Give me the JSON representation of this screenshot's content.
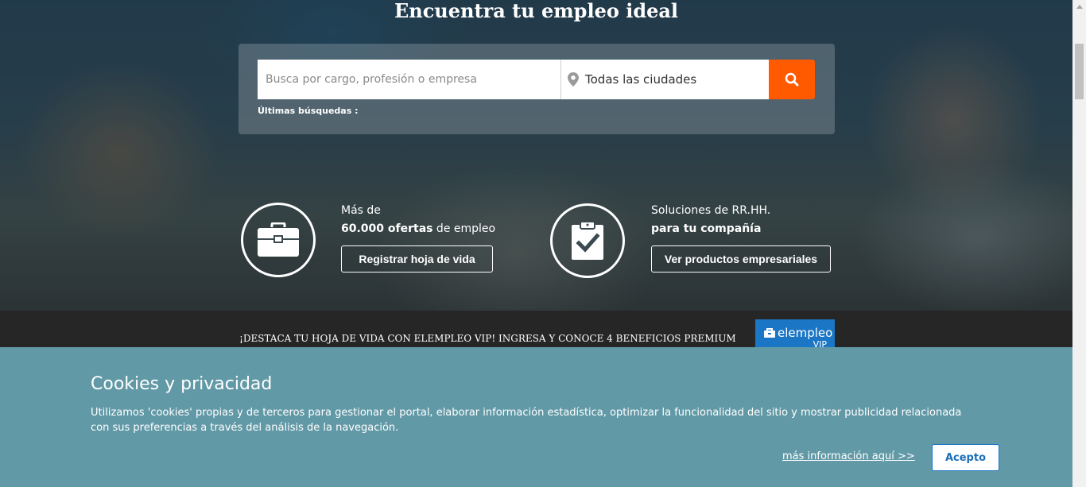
{
  "hero": {
    "title": "Encuentra tu empleo ideal",
    "search_placeholder": "Busca por cargo, profesión o empresa",
    "city_value": "Todas las ciudades",
    "recent_label": "Últimas búsquedas :"
  },
  "features": [
    {
      "line1": "Más de",
      "line2_bold": "60.000 ofertas",
      "line2_rest": " de empleo",
      "button": "Registrar hoja de vida",
      "icon": "briefcase-icon"
    },
    {
      "line1": "Soluciones de RR.HH.",
      "line2_bold": "para tu compañía",
      "line2_rest": "",
      "button": "Ver productos empresariales",
      "icon": "clipboard-check-icon"
    }
  ],
  "vip": {
    "text": "¡DESTACA TU HOJA DE VIDA CON ELEMPLEO VIP! INGRESA Y CONOCE 4 BENEFICIOS PREMIUM",
    "logo": "elempleo",
    "sub": "VIP"
  },
  "cookies": {
    "title": "Cookies y privacidad",
    "body": "Utilizamos 'cookies' propias y de terceros para gestionar el portal, elaborar información estadística, optimizar la funcionalidad del sitio y mostrar publicidad relacionada con sus preferencias a través del análisis de la navegación.",
    "more_link": "más información aquí >>",
    "accept": "Acepto"
  },
  "colors": {
    "search_button": "#ff5a00",
    "cookie_panel": "#6299a6",
    "vip_badge": "#1b76c5",
    "vip_bar": "#262626"
  }
}
